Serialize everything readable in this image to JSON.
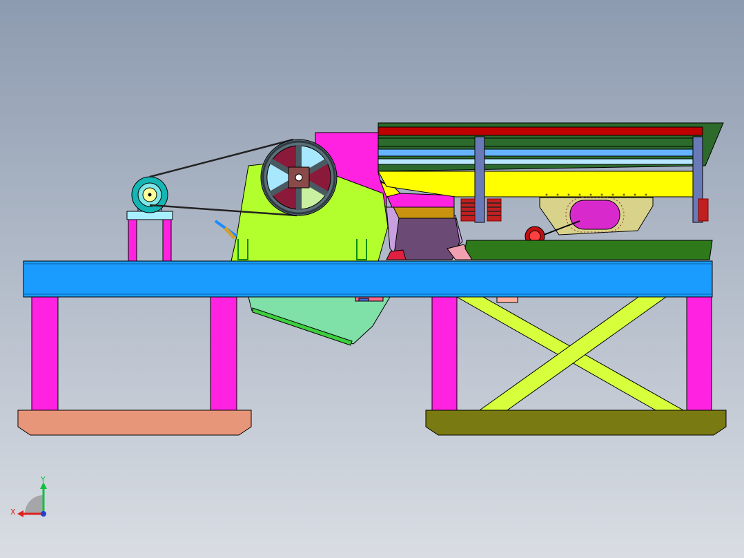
{
  "view": {
    "background_top": "#8d9bb0",
    "background_bottom": "#d9dde3"
  },
  "triad": {
    "x_label": "X",
    "y_label": "Y",
    "x_color": "#e02020",
    "y_color": "#10c040",
    "z_color": "#2040d0"
  },
  "colors": {
    "table_top": "#1a9cff",
    "legs": "#ff22e0",
    "left_base": "#e8967a",
    "right_base": "#7a7a12",
    "cross_brace": "#d7ff3c",
    "crusher_body": "#b3ff2e",
    "hopper": "#ff22e0",
    "flywheel": "#5a6f78",
    "flywheel_hub": "#8b4a4a",
    "motor": "#15b5b5",
    "discharge_chute": "#7fe0a8",
    "screen_frame": "#2d6b2d",
    "screen_band_red": "#c00000",
    "screen_band_blue": "#66b3ff",
    "screen_band_lightblue": "#b8e8ff",
    "screen_band_yellow": "#ffff00",
    "screen_post": "#6a7ab8",
    "vibrator_housing": "#d9d28a",
    "vibrator_window": "#d82acc",
    "spring": "#c02020",
    "feed_tray": "#2e7a1a",
    "gold_plate": "#c89410",
    "dark_purple": "#6b4a75"
  }
}
